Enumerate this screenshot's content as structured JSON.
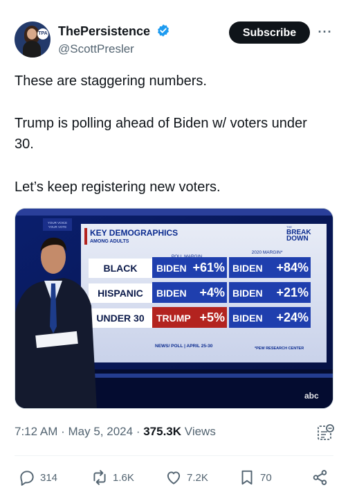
{
  "author": {
    "display_name": "ThePersistence",
    "handle": "@ScottPresler",
    "verified": true,
    "avatar_badge": "TPA"
  },
  "header": {
    "subscribe_label": "Subscribe",
    "more_label": "···"
  },
  "tweet": {
    "paragraphs": [
      "These are staggering numbers.",
      "Trump is polling ahead of Biden w/ voters under 30.",
      "Let’s keep registering new voters."
    ]
  },
  "media": {
    "corner_logo": "YOUR VOICE YOUR VOTE",
    "title": "KEY DEMOGRAPHICS",
    "subtitle": "AMONG ADULTS",
    "brand": "THE BREAK DOWN",
    "col_poll": "POLL MARGIN",
    "col_2020": "2020 MARGIN*",
    "rows": [
      {
        "group": "BLACK",
        "poll_candidate": "BIDEN",
        "poll_value": "+61%",
        "past_candidate": "BIDEN",
        "past_value": "+84%"
      },
      {
        "group": "HISPANIC",
        "poll_candidate": "BIDEN",
        "poll_value": "+4%",
        "past_candidate": "BIDEN",
        "past_value": "+21%"
      },
      {
        "group": "UNDER 30",
        "poll_candidate": "TRUMP",
        "poll_value": "+5%",
        "past_candidate": "BIDEN",
        "past_value": "+24%"
      }
    ],
    "source_left": "NEWS/ POLL | APRIL 25-30",
    "source_right": "*PEW RESEARCH CENTER",
    "network_logo": "abc",
    "colors": {
      "biden": "#1f3fae",
      "trump": "#b3231f",
      "panel": "#0b2b8f"
    }
  },
  "meta": {
    "time": "7:12 AM",
    "separator": "·",
    "date": "May 5, 2024",
    "views_count": "375.3K",
    "views_label": "Views"
  },
  "actions": {
    "replies": "314",
    "reposts": "1.6K",
    "likes": "7.2K",
    "bookmarks": "70"
  },
  "colors": {
    "text": "#0f1419",
    "secondary": "#536471",
    "verified": "#1d9bf0"
  }
}
